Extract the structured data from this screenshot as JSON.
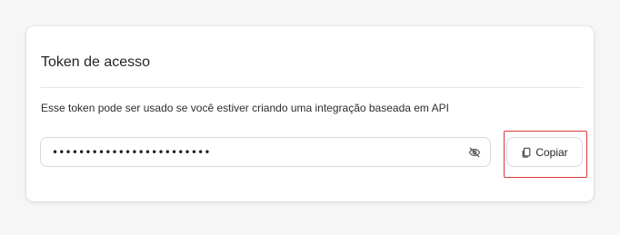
{
  "card": {
    "title": "Token de acesso",
    "description": "Esse token pode ser usado se você estiver criando uma integração baseada em API"
  },
  "token_field": {
    "value": "••••••••••••••••••••••••",
    "visibility_icon": "eye-off-icon"
  },
  "copy_button": {
    "label": "Copiar",
    "icon": "copy-icon"
  },
  "colors": {
    "highlight": "#d9383a",
    "border": "#d9d9d9",
    "background": "#f6f6f6"
  }
}
